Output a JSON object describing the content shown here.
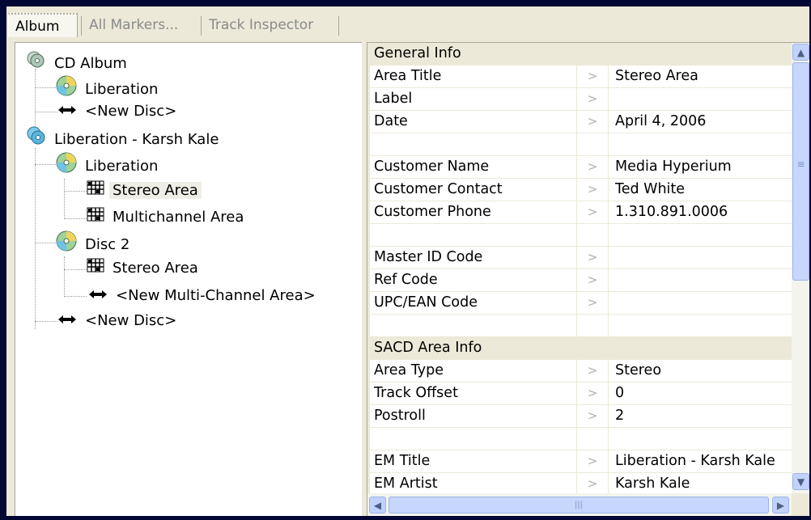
{
  "tabs": [
    {
      "label": "Album",
      "active": true
    },
    {
      "label": "All Markers...",
      "active": false
    },
    {
      "label": "Track Inspector",
      "active": false
    }
  ],
  "tree": {
    "selected": "Stereo Area",
    "nodes": [
      {
        "label": "CD Album",
        "icon": "cd-album-icon",
        "level": 0
      },
      {
        "label": "Liberation",
        "icon": "disc-icon",
        "level": 1
      },
      {
        "label": "<New Disc>",
        "icon": "new-item-arrows-icon",
        "level": 1
      },
      {
        "label": "Liberation - Karsh Kale",
        "icon": "sacd-album-icon",
        "level": 0
      },
      {
        "label": "Liberation",
        "icon": "disc-icon",
        "level": 1
      },
      {
        "label": "Stereo Area",
        "icon": "area-icon",
        "level": 2
      },
      {
        "label": "Multichannel Area",
        "icon": "area-icon",
        "level": 2
      },
      {
        "label": "Disc 2",
        "icon": "disc-icon",
        "level": 1
      },
      {
        "label": "Stereo Area",
        "icon": "area-icon",
        "level": 2
      },
      {
        "label": "<New Multi-Channel Area>",
        "icon": "new-item-arrows-icon",
        "level": 2
      },
      {
        "label": "<New Disc>",
        "icon": "new-item-arrows-icon",
        "level": 1
      }
    ]
  },
  "properties": {
    "arrow_glyph": ">",
    "rows": [
      {
        "type": "section",
        "name": "General Info"
      },
      {
        "type": "field",
        "name": "Area Title",
        "value": "Stereo Area"
      },
      {
        "type": "field",
        "name": "Label",
        "value": ""
      },
      {
        "type": "field",
        "name": "Date",
        "value": "April 4, 2006"
      },
      {
        "type": "blank"
      },
      {
        "type": "field",
        "name": "Customer Name",
        "value": "Media Hyperium"
      },
      {
        "type": "field",
        "name": "Customer Contact",
        "value": "Ted White"
      },
      {
        "type": "field",
        "name": "Customer Phone",
        "value": "1.310.891.0006"
      },
      {
        "type": "blank"
      },
      {
        "type": "field",
        "name": "Master ID Code",
        "value": ""
      },
      {
        "type": "field",
        "name": "Ref Code",
        "value": ""
      },
      {
        "type": "field",
        "name": "UPC/EAN Code",
        "value": ""
      },
      {
        "type": "blank"
      },
      {
        "type": "section",
        "name": "SACD Area Info"
      },
      {
        "type": "field",
        "name": "Area Type",
        "value": "Stereo"
      },
      {
        "type": "field",
        "name": "Track Offset",
        "value": "0"
      },
      {
        "type": "field",
        "name": "Postroll",
        "value": "2"
      },
      {
        "type": "blank"
      },
      {
        "type": "field",
        "name": "EM Title",
        "value": "Liberation - Karsh Kale"
      },
      {
        "type": "field",
        "name": "EM Artist",
        "value": "Karsh Kale"
      }
    ]
  },
  "scroll": {
    "up": "▲",
    "down": "▼",
    "left": "◀",
    "right": "▶",
    "grip": "≡",
    "hgrip": "|||"
  },
  "colors": {
    "desktop": "#020733",
    "panel": "#ece9d8",
    "scrollbar_thumb": "#c6d6fc"
  }
}
